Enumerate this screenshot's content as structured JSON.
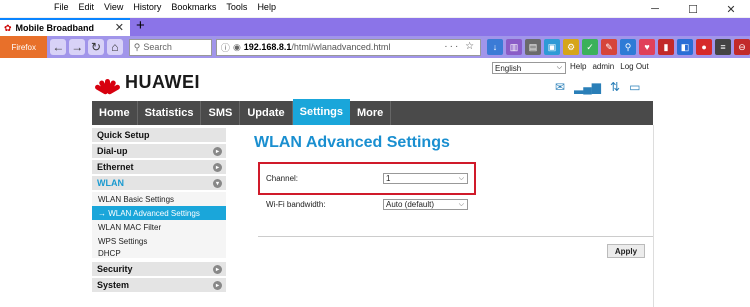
{
  "menu": [
    "File",
    "Edit",
    "View",
    "History",
    "Bookmarks",
    "Tools",
    "Help"
  ],
  "tab": {
    "title": "Mobile Broadband",
    "close": "✕",
    "new": "+"
  },
  "firefox_label": "Firefox",
  "search": {
    "placeholder": "Search"
  },
  "url": {
    "host": "192.168.8.1",
    "path": "/html/wlanadvanced.html"
  },
  "brand": "HUAWEI",
  "language": "English",
  "toplinks": {
    "help": "Help",
    "user": "admin",
    "logout": "Log Out"
  },
  "nav": [
    "Home",
    "Statistics",
    "SMS",
    "Update",
    "Settings",
    "More"
  ],
  "sidebar": {
    "quick": "Quick Setup",
    "dialup": "Dial-up",
    "ethernet": "Ethernet",
    "wlan": "WLAN",
    "sub": [
      "WLAN Basic Settings",
      "→ WLAN Advanced Settings",
      "WLAN MAC Filter",
      "WPS Settings",
      "DHCP"
    ],
    "security": "Security",
    "system": "System"
  },
  "page_title": "WLAN Advanced Settings",
  "channel": {
    "label": "Channel:",
    "value": "1"
  },
  "bandwidth": {
    "label": "Wi-Fi bandwidth:",
    "value": "Auto (default)"
  },
  "apply": "Apply",
  "colors": {
    "accent": "#1aa6da",
    "brand_red": "#d7000f",
    "nav_bg": "#4a4a4a",
    "tab_bar": "#8b74e8"
  }
}
